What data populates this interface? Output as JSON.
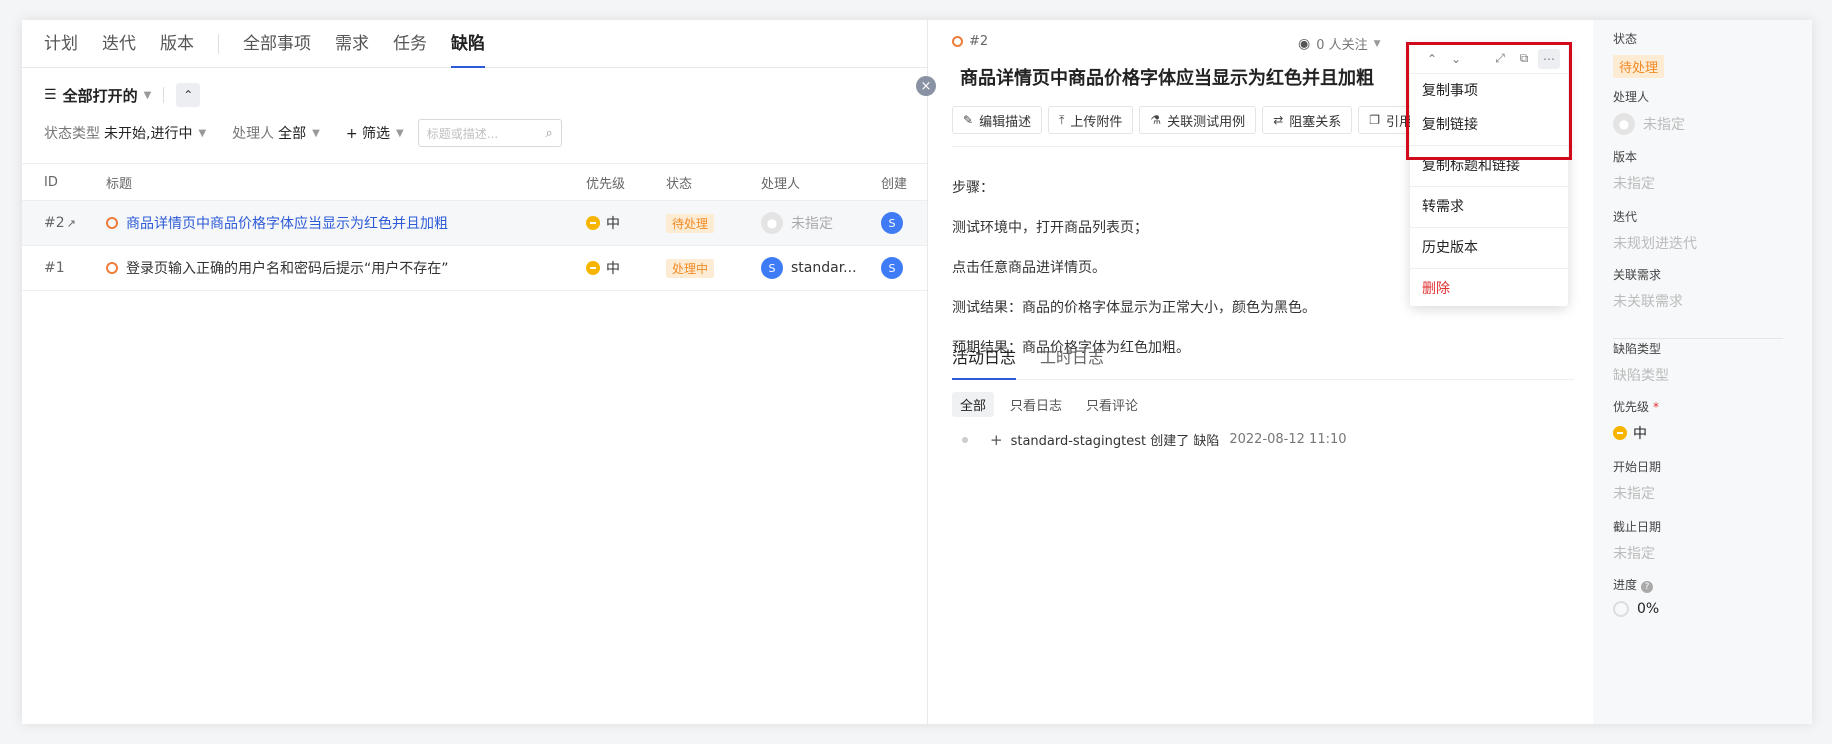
{
  "nav": {
    "tabs": [
      {
        "label": "计划"
      },
      {
        "label": "迭代"
      },
      {
        "label": "版本"
      },
      {
        "label": "全部事项"
      },
      {
        "label": "需求"
      },
      {
        "label": "任务"
      },
      {
        "label": "缺陷"
      }
    ],
    "active": "缺陷"
  },
  "filters": {
    "view_label": "全部打开的",
    "status_type_label": "状态类型",
    "status_type_value": "未开始,进行中",
    "owner_label": "处理人",
    "owner_value": "全部",
    "more_filter_label": "+ 筛选",
    "search_placeholder": "标题或描述..."
  },
  "table": {
    "columns": {
      "id": "ID",
      "title": "标题",
      "priority": "优先级",
      "status": "状态",
      "owner": "处理人",
      "creator": "创建"
    },
    "rows": [
      {
        "id": "#2",
        "title": "商品详情页中商品价格字体应当显示为红色并且加粗",
        "priority": "中",
        "status": "待处理",
        "owner": "未指定",
        "creator_initial": "S"
      },
      {
        "id": "#1",
        "title": "登录页输入正确的用户名和密码后提示“用户不存在”",
        "priority": "中",
        "status": "处理中",
        "owner": "standar...",
        "owner_initial": "S",
        "creator_initial": "S"
      }
    ]
  },
  "detail": {
    "id": "#2",
    "watch_label": "0 人关注",
    "title": "商品详情页中商品价格字体应当显示为红色并且加粗",
    "toolbar": {
      "edit": "编辑描述",
      "upload": "上传附件",
      "link_test": "关联测试用例",
      "block": "阻塞关系",
      "cite": "引用"
    },
    "description": [
      "步骤：",
      "测试环境中，打开商品列表页；",
      "点击任意商品进详情页。",
      "测试结果：商品的价格字体显示为正常大小，颜色为黑色。",
      "预期结果：商品价格字体为红色加粗。"
    ],
    "log_tabs": [
      "活动日志",
      "工时日志"
    ],
    "sub_tabs": [
      "全部",
      "只看日志",
      "只看评论"
    ],
    "log_entry": {
      "text": "standard-stagingtest 创建了 缺陷",
      "time": "2022-08-12 11:10"
    }
  },
  "menu": {
    "items": [
      "复制事项",
      "复制链接",
      "复制标题和链接",
      "转需求",
      "历史版本",
      "删除"
    ]
  },
  "props": {
    "status_label": "状态",
    "status_value": "待处理",
    "owner_label": "处理人",
    "owner_value": "未指定",
    "version_label": "版本",
    "version_value": "未指定",
    "iteration_label": "迭代",
    "iteration_value": "未规划进迭代",
    "req_label": "关联需求",
    "req_value": "未关联需求",
    "bugtype_label": "缺陷类型",
    "bugtype_value": "缺陷类型",
    "priority_label": "优先级",
    "priority_value": "中",
    "start_label": "开始日期",
    "start_value": "未指定",
    "end_label": "截止日期",
    "end_value": "未指定",
    "progress_label": "进度",
    "progress_value": "0%"
  },
  "colors": {
    "accent": "#2d5bd7",
    "warning": "#f08a24",
    "danger": "#e03030",
    "priority": "#f7b500",
    "highlight": "#d10a1b"
  }
}
